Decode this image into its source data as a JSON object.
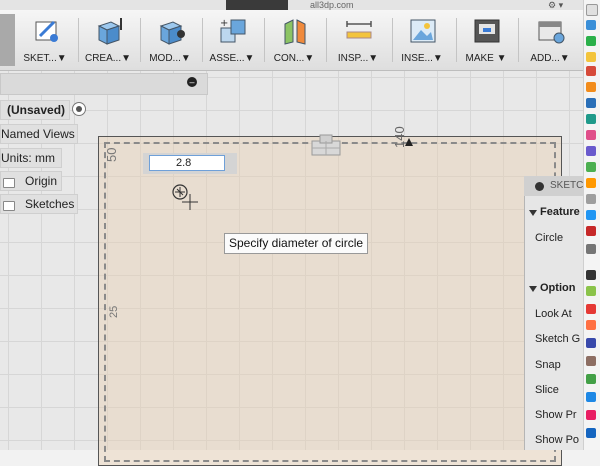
{
  "window": {
    "url_fragment": "all3dp.com"
  },
  "toolbar": {
    "groups": [
      {
        "label": "SKET...▼",
        "icon": "sketch-icon"
      },
      {
        "label": "CREA...▼",
        "icon": "create-icon"
      },
      {
        "label": "MOD...▼",
        "icon": "modify-icon"
      },
      {
        "label": "ASSE...▼",
        "icon": "assemble-icon"
      },
      {
        "label": "CON...▼",
        "icon": "construct-icon"
      },
      {
        "label": "INSP...▼",
        "icon": "inspect-icon"
      },
      {
        "label": "INSE...▼",
        "icon": "insert-icon"
      },
      {
        "label": "MAKE ▼",
        "icon": "make-icon"
      },
      {
        "label": "ADD...▼",
        "icon": "addins-icon"
      }
    ]
  },
  "browser": {
    "root": "(Unsaved)",
    "items": [
      "Named Views",
      "Units: mm",
      "Origin",
      "Sketches"
    ]
  },
  "canvas": {
    "dim_height": "50",
    "dim_width": "140",
    "dim_left": "25",
    "diameter_value": "2.8",
    "tooltip": "Specify diameter of circle"
  },
  "sketch_panel": {
    "title": "SKETCH",
    "features_header": "Feature",
    "circle_label": "Circle",
    "options_header": "Option",
    "options": [
      "Look At",
      "Sketch G",
      "Snap",
      "Slice",
      "Show Pr",
      "Show Po"
    ]
  },
  "colors": {
    "sheet": "#e8d0b4",
    "accent": "#6fa0d8"
  }
}
